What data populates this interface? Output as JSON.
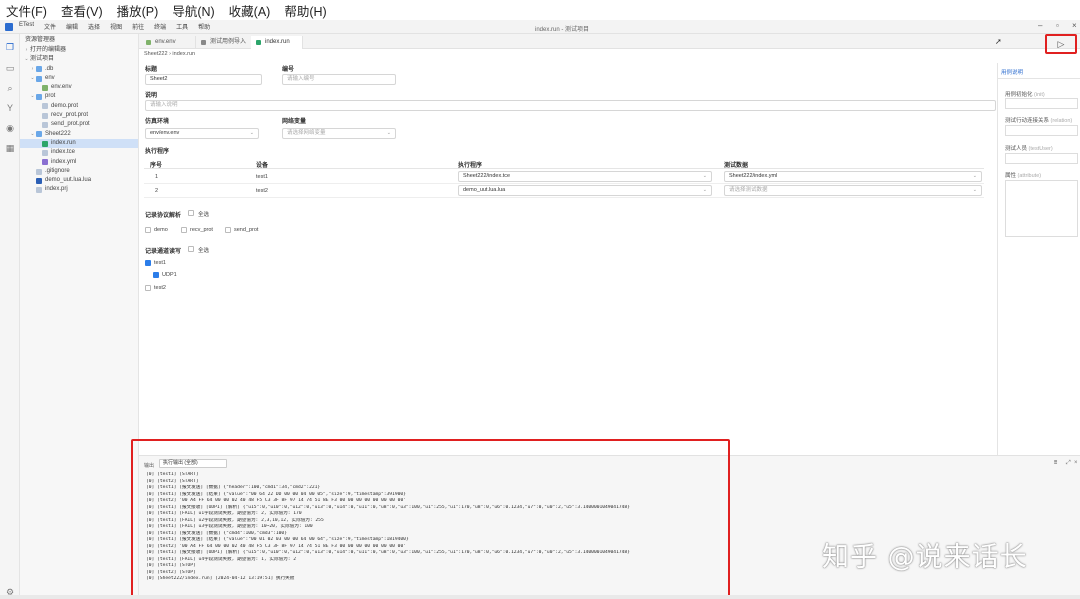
{
  "top_menu": [
    "文件(F)",
    "查看(V)",
    "播放(P)",
    "导航(N)",
    "收藏(A)",
    "帮助(H)"
  ],
  "title_menu": [
    "ETest",
    "文件",
    "编辑",
    "选择",
    "视图",
    "前往",
    "终端",
    "工具",
    "帮助"
  ],
  "window_title": "index.run - 测试项目",
  "explorer": {
    "header": "资源管理器",
    "items": [
      {
        "label": "打开的编辑器",
        "indent": 0,
        "arrow": "›",
        "icon": "none"
      },
      {
        "label": "测试项目",
        "indent": 0,
        "arrow": "⌄",
        "icon": "none"
      },
      {
        "label": ".db",
        "indent": 1,
        "arrow": "›",
        "icon": "folder"
      },
      {
        "label": "env",
        "indent": 1,
        "arrow": "⌄",
        "icon": "folder"
      },
      {
        "label": "env.env",
        "indent": 2,
        "arrow": "",
        "icon": "env"
      },
      {
        "label": "prot",
        "indent": 1,
        "arrow": "⌄",
        "icon": "folder"
      },
      {
        "label": "demo.prot",
        "indent": 2,
        "arrow": "",
        "icon": "file"
      },
      {
        "label": "recv_prot.prot",
        "indent": 2,
        "arrow": "",
        "icon": "file"
      },
      {
        "label": "send_prot.prot",
        "indent": 2,
        "arrow": "",
        "icon": "file"
      },
      {
        "label": "Sheet222",
        "indent": 1,
        "arrow": "⌄",
        "icon": "folder"
      },
      {
        "label": "index.run",
        "indent": 2,
        "arrow": "",
        "icon": "run",
        "selected": true
      },
      {
        "label": "index.tce",
        "indent": 2,
        "arrow": "",
        "icon": "file"
      },
      {
        "label": "index.yml",
        "indent": 2,
        "arrow": "",
        "icon": "yml"
      },
      {
        "label": ".gitignore",
        "indent": 1,
        "arrow": "",
        "icon": "file"
      },
      {
        "label": "demo_uut.lua.lua",
        "indent": 1,
        "arrow": "",
        "icon": "lua"
      },
      {
        "label": "index.prj",
        "indent": 1,
        "arrow": "",
        "icon": "file"
      }
    ]
  },
  "tabs": [
    {
      "label": "env.env",
      "color": "#7fb26a"
    },
    {
      "label": "测试用例导入",
      "color": "#888888"
    },
    {
      "label": "index.run",
      "color": "#2ca56b"
    }
  ],
  "breadcrumb": "Sheet222 › index.run",
  "form": {
    "title_label": "标题",
    "title_value": "Sheet2",
    "number_label": "编号",
    "number_placeholder": "请输入编号",
    "desc_label": "说明",
    "desc_placeholder": "请输入说明",
    "env_label": "仿真环境",
    "env_value": "env/env.env",
    "net_label": "网络变量",
    "net_placeholder": "请选择网络变量"
  },
  "procedure": {
    "label": "执行程序",
    "headers": [
      "序号",
      "设备",
      "执行程序",
      "测试数据"
    ],
    "rows": [
      {
        "no": "1",
        "device": "test1",
        "program": "Sheet222/index.tce",
        "data": "Sheet222/index.yml"
      },
      {
        "no": "2",
        "device": "test2",
        "program": "demo_uut.lua.lua",
        "data": "请选择测试数据"
      }
    ]
  },
  "protocol": {
    "label": "记录协议解析",
    "select_all": "全选",
    "options": [
      "demo",
      "recv_prot",
      "send_prot"
    ]
  },
  "channel": {
    "label": "记录通道读写",
    "select_all": "全选",
    "groups": [
      {
        "name": "test1",
        "checked": true,
        "children": [
          {
            "name": "UDP1",
            "checked": true
          }
        ]
      },
      {
        "name": "test2",
        "checked": false,
        "children": []
      }
    ]
  },
  "right_panel": {
    "tab": "用例说明",
    "fields": [
      {
        "label": "用例初始化",
        "hint": "(init)"
      },
      {
        "label": "测试行动连接关系",
        "hint": "(relation)"
      },
      {
        "label": "测试人员",
        "hint": "(testUser)"
      },
      {
        "label": "属性",
        "hint": "(attribute)"
      }
    ]
  },
  "run_icon": "play-icon",
  "output": {
    "title": "输出",
    "channel": "执行输出 (全部)",
    "lines": [
      "[0] [test1] [START]",
      "[0] [test2] [START]",
      "[0] [test1] [报文发送] [数据] {\"header\":100,\"cmd1\":34,\"cmd2\":221}",
      "[0] [test1] [报文发送] [结果] {\"value\":\"00 64 22 DD 00 00 04 00 05\",\"size\":9,\"timestamp\":391900}",
      "[0] [test2] '00 A4 FF 64 00 00 02 40 48 F5 C3 3F 8F 97 14 74 51 8E F3 00 00 00 00 00 00 00 00'",
      "[0] [test1] [报文接收] [UDP1] [解析] {\"u15\":0,\"u10\":0,\"u12\":0,\"u13\":0,\"u14\":0,\"u11\":0,\"u8\":0,\"u3\":100,\"u1\":255,\"u1\":170,\"u8\":0,\"u6\":0.1234,\"u7\":0,\"u0\":2,\"u5\":3.1400001049041748}",
      "[0] [test1] [FAIL] u1字段测试失败, 期望值为: 2, 实际值为: 170",
      "[0] [test1] [FAIL] u2字段测试失败, 期望值为: 2,3,10,12, 实际值为: 255",
      "[0] [test1] [FAIL] u3字段测试失败, 期望值为: 10~20, 实际值为: 100",
      "[0] [test1] [报文发送] [数据] {\"cmd4\":100,\"cmd3\":100}",
      "[0] [test1] [报文发送] [结果] {\"value\":\"00 01 02 03 00 00 64 00 64\",\"size\":9,\"timestamp\":1819400}",
      "[0] [test2] '00 A4 FF 64 00 00 02 40 48 F5 C3 3F 8F 97 14 74 51 8E F3 00 00 00 00 00 00 00 00'",
      "[0] [test1] [报文接收] [UDP1] [解析] {\"u15\":0,\"u10\":0,\"u12\":0,\"u13\":0,\"u14\":0,\"u11\":0,\"u8\":0,\"u3\":100,\"u1\":255,\"u1\":170,\"u8\":0,\"u6\":0.1234,\"u7\":0,\"u0\":2,\"u5\":3.1400001049041748}",
      "[0] [test1] [FAIL] u4字段测试失败, 期望值为: 1, 实际值为: 2",
      "[0] [test1] [STOP]",
      "[0] [test2] [STOP]",
      "[0] [Sheet222/index.run] [2024-04-12 13:19:51] 执行失败"
    ]
  },
  "watermark": "知乎 @说来话长",
  "colors": {
    "accent": "#2b6ccf",
    "highlight_border": "#e02020",
    "checkbox": "#2b7de9"
  }
}
